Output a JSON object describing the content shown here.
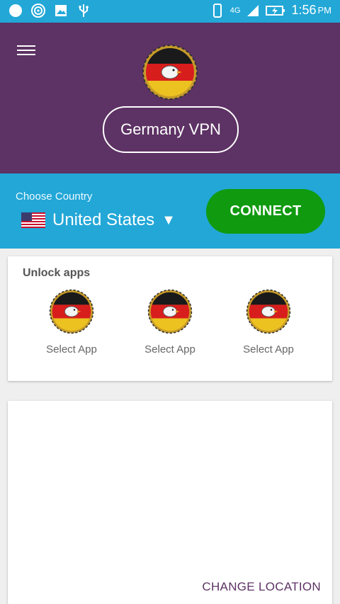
{
  "status_bar": {
    "time": "1:56",
    "ampm": "PM",
    "network": "4G",
    "icons": [
      "circle-icon",
      "hotspot-icon",
      "image-icon",
      "usb-icon",
      "phone-icon",
      "signal-icon",
      "battery-icon"
    ]
  },
  "header": {
    "title": "Germany VPN"
  },
  "connect_panel": {
    "choose_label": "Choose Country",
    "country_name": "United States",
    "dropdown_arrow": "▼",
    "connect_label": "CONNECT"
  },
  "unlock_apps": {
    "title": "Unlock apps",
    "apps": [
      {
        "label": "Select App"
      },
      {
        "label": "Select App"
      },
      {
        "label": "Select App"
      }
    ]
  },
  "map_card": {
    "change_location_label": "CHANGE LOCATION"
  },
  "colors": {
    "status_bar": "#22a7d7",
    "header": "#5d3264",
    "connect_button": "#0f9a0f",
    "accent_text": "#5d3264"
  }
}
